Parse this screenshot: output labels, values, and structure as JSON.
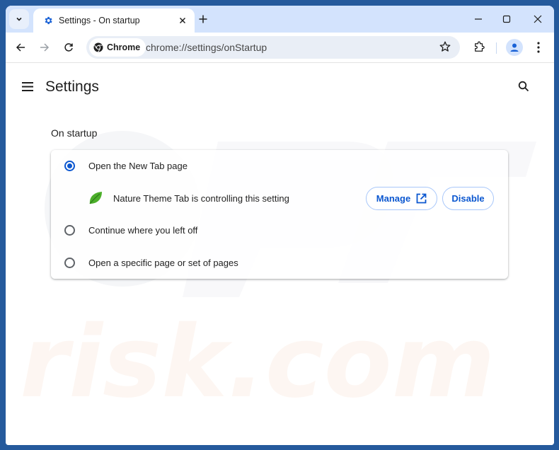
{
  "browser": {
    "tab": {
      "title": "Settings - On startup",
      "icon": "gear-icon"
    },
    "new_tab_label": "+",
    "omnibox": {
      "chip_label": "Chrome",
      "url": "chrome://settings/onStartup"
    },
    "window_controls": [
      "minimize-icon",
      "maximize-icon",
      "close-icon"
    ]
  },
  "settings": {
    "title": "Settings",
    "section_title": "On startup",
    "options": [
      {
        "label": "Open the New Tab page",
        "selected": true
      },
      {
        "label": "Continue where you left off",
        "selected": false
      },
      {
        "label": "Open a specific page or set of pages",
        "selected": false
      }
    ],
    "extension_notice": {
      "text": "Nature Theme Tab is controlling this setting",
      "icon": "leaf-icon",
      "manage_label": "Manage",
      "disable_label": "Disable"
    }
  },
  "colors": {
    "accent": "#0b57d0",
    "tabstrip": "#d3e3fd",
    "frame": "#255a9c"
  },
  "watermark": {
    "text": "risk.com"
  }
}
